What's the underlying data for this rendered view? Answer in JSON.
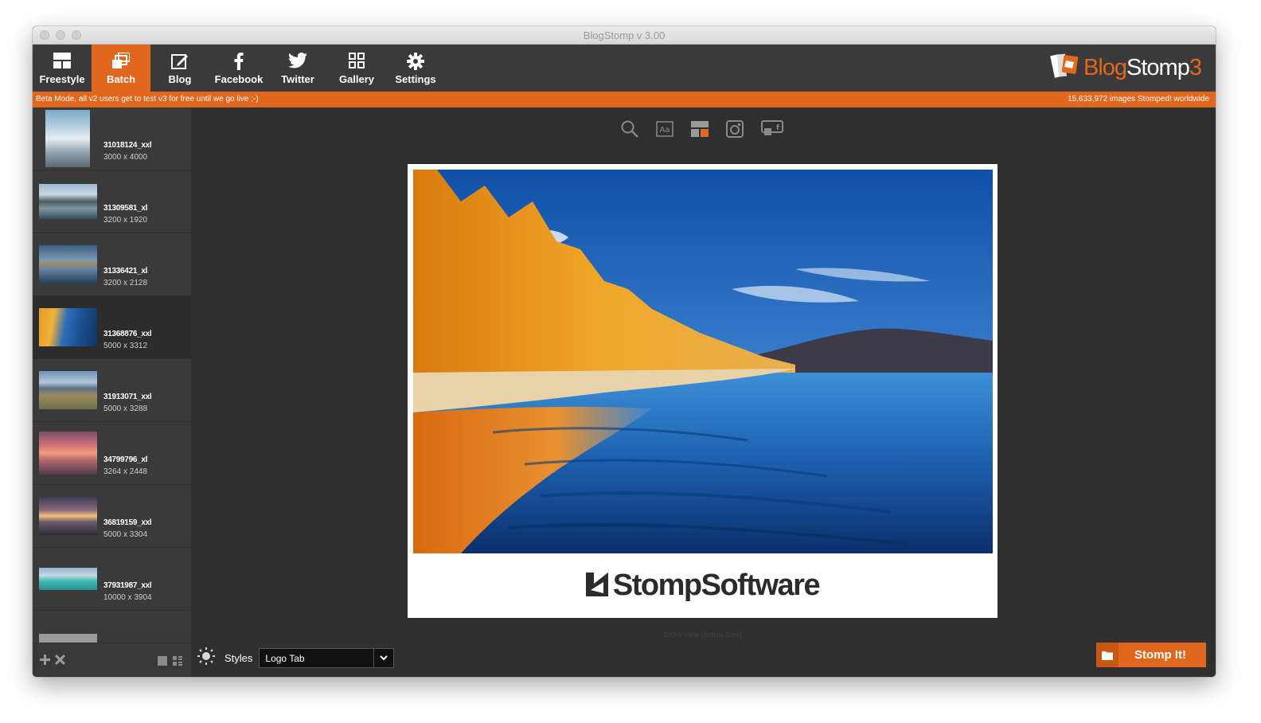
{
  "window": {
    "title": "BlogStomp v 3.00"
  },
  "toolbar": {
    "items": [
      {
        "label": "Freestyle",
        "icon": "freestyle-icon"
      },
      {
        "label": "Batch",
        "icon": "batch-icon",
        "active": true
      },
      {
        "label": "Blog",
        "icon": "edit-icon"
      },
      {
        "label": "Facebook",
        "icon": "facebook-icon"
      },
      {
        "label": "Twitter",
        "icon": "twitter-icon"
      },
      {
        "label": "Gallery",
        "icon": "grid-icon"
      },
      {
        "label": "Settings",
        "icon": "gear-icon"
      }
    ],
    "brand": {
      "part1": "Blog",
      "part2": "Stomp",
      "part3": "3"
    }
  },
  "banner": {
    "left": "Beta Mode, all v2 users get to test v3 for free until we go live ;-)",
    "right": "15,633,972 images Stomped! worldwide"
  },
  "sidebar": {
    "images": [
      {
        "name": "31018124_xxl",
        "size": "3000 x 4000"
      },
      {
        "name": "31309581_xl",
        "size": "3200 x 1920"
      },
      {
        "name": "31336421_xl",
        "size": "3200 x 2128"
      },
      {
        "name": "31368876_xxl",
        "size": "5000 x 3312",
        "selected": true
      },
      {
        "name": "31913071_xxl",
        "size": "5000 x 3288"
      },
      {
        "name": "34799796_xl",
        "size": "3264 x 2448"
      },
      {
        "name": "36819159_xxl",
        "size": "5000 x 3304"
      },
      {
        "name": "37931987_xxl",
        "size": "10000 x 3904"
      }
    ]
  },
  "preview": {
    "logo_text": "StompSoftware",
    "zoom_note": "100% View (Actual Size)"
  },
  "styles": {
    "label": "Styles",
    "value": "Logo Tab"
  },
  "stomp_button": {
    "label": "Stomp It!"
  },
  "colors": {
    "accent": "#e0671d",
    "toolbar": "#3a3a3a",
    "background": "#2f2f2f"
  }
}
